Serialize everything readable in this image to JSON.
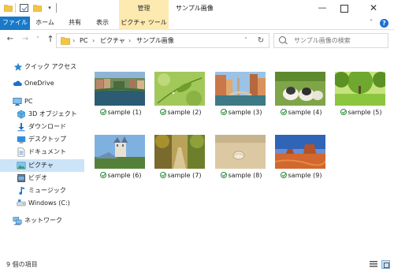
{
  "window": {
    "title": "サンプル画像",
    "context_tab_group": "管理",
    "minimize": "—",
    "close": "✕"
  },
  "quick_access_toolbar": {
    "dropdown": "▾"
  },
  "ribbon": {
    "tabs": [
      "ファイル",
      "ホーム",
      "共有",
      "表示"
    ],
    "context_tab": "ピクチャ ツール",
    "collapse": "˅",
    "help": "?"
  },
  "navigation": {
    "back": "←",
    "forward": "→",
    "recent": "˅",
    "up": "↑"
  },
  "address": {
    "crumbs": [
      "PC",
      "ピクチャ",
      "サンプル画像"
    ],
    "separator": "›",
    "dropdown": "˅",
    "refresh": "↻"
  },
  "search": {
    "placeholder": "サンプル画像の検索"
  },
  "nav_pane": {
    "items": [
      {
        "label": "クイック アクセス",
        "icon": "star-icon"
      },
      {
        "label": "OneDrive",
        "icon": "cloud-icon"
      },
      {
        "label": "PC",
        "icon": "computer-icon"
      },
      {
        "label": "3D オブジェクト",
        "icon": "cube-icon"
      },
      {
        "label": "ダウンロード",
        "icon": "download-icon"
      },
      {
        "label": "デスクトップ",
        "icon": "desktop-icon"
      },
      {
        "label": "ドキュメント",
        "icon": "document-icon"
      },
      {
        "label": "ピクチャ",
        "icon": "pictures-icon",
        "selected": true
      },
      {
        "label": "ビデオ",
        "icon": "video-icon"
      },
      {
        "label": "ミュージック",
        "icon": "music-icon"
      },
      {
        "label": "Windows (C:)",
        "icon": "drive-icon"
      },
      {
        "label": "ネットワーク",
        "icon": "network-icon"
      }
    ]
  },
  "files": [
    {
      "name": "sample (1)",
      "scene": "canal-town"
    },
    {
      "name": "sample (2)",
      "scene": "green-leaf"
    },
    {
      "name": "sample (3)",
      "scene": "venice-canal"
    },
    {
      "name": "sample (4)",
      "scene": "ducklings"
    },
    {
      "name": "sample (5)",
      "scene": "green-park"
    },
    {
      "name": "sample (6)",
      "scene": "castle"
    },
    {
      "name": "sample (7)",
      "scene": "forest-path"
    },
    {
      "name": "sample (8)",
      "scene": "sand-shell"
    },
    {
      "name": "sample (9)",
      "scene": "desert-butte"
    }
  ],
  "status": {
    "item_count": "9 個の項目"
  },
  "colors": {
    "file_tab": "#1979ca",
    "context_tab": "#fdeab0",
    "selected_nav": "#cce4f7",
    "folder": "#f4c542",
    "sync_ok": "#2c8c3a"
  }
}
